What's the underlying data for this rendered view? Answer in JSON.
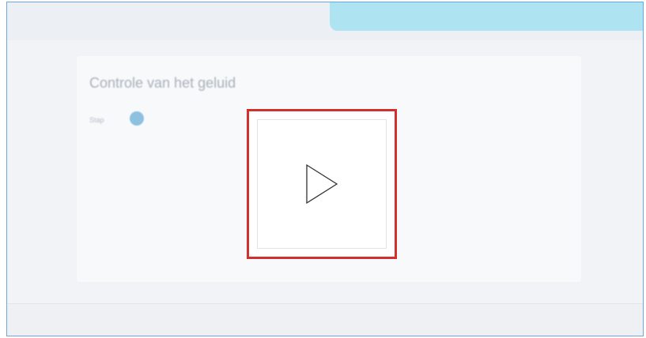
{
  "header": {
    "app_title": "",
    "app_subtitle": ""
  },
  "card": {
    "title": "Controle van het geluid",
    "step_label": "Stap",
    "line1": "",
    "checkbox_label": "",
    "line2": ""
  },
  "footer": {
    "next_label": ""
  },
  "video": {
    "play_icon": "play-icon"
  },
  "colors": {
    "highlight_border": "#d32f2f",
    "banner": "#aee3f1",
    "accent": "#8ec1e0"
  }
}
